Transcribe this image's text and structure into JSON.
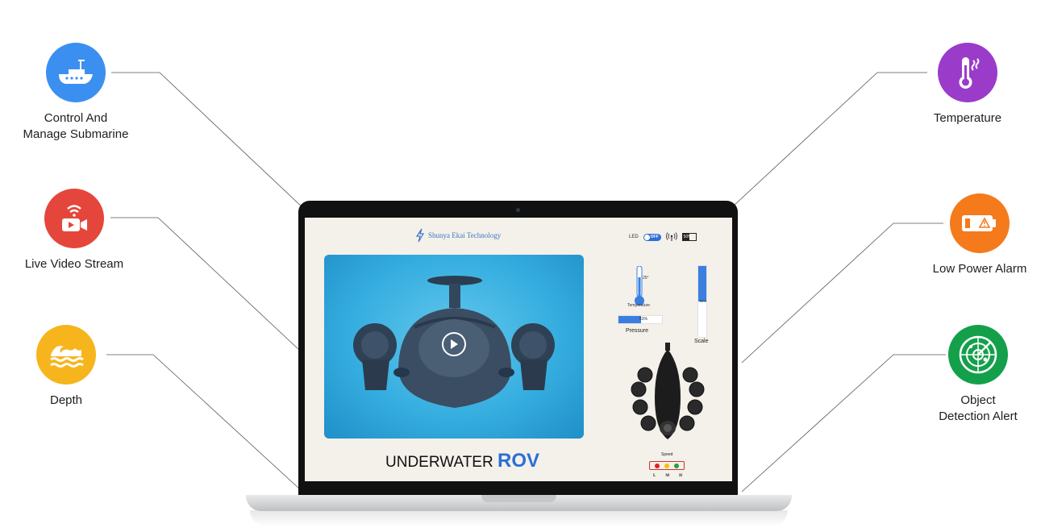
{
  "features_left": [
    {
      "label": "Control And\nManage Submarine",
      "icon": "submarine-icon",
      "color": "#3b8ff0"
    },
    {
      "label": "Live Video Stream",
      "icon": "video-camera-icon",
      "color": "#e5463b"
    },
    {
      "label": "Depth",
      "icon": "water-waves-icon",
      "color": "#f6b51c"
    }
  ],
  "features_right": [
    {
      "label": "Temperature",
      "icon": "thermometer-icon",
      "color": "#9a3cc9"
    },
    {
      "label": "Low Power Alarm",
      "icon": "low-battery-icon",
      "color": "#f57a1c"
    },
    {
      "label": "Object\nDetection Alert",
      "icon": "radar-icon",
      "color": "#14a04b"
    }
  ],
  "app": {
    "brand": "Shunya Ekai Technology",
    "led_label": "LED",
    "led_state": "OFF",
    "battery_text": "50%",
    "battery_level": 0.5,
    "title_prefix": "UNDERWATER",
    "title_main": "ROV",
    "temperature_value": "25°",
    "temperature_label": "Temperature",
    "pressure_value": "51%",
    "pressure_level": 0.51,
    "pressure_label": "Pressure",
    "scale_value": "50%",
    "scale_level": 0.5,
    "scale_label": "Scale",
    "speed_label": "Speed",
    "speed_levels": [
      "L",
      "M",
      "H"
    ],
    "speed_colors": [
      "#e02020",
      "#f2c200",
      "#1aa33a"
    ]
  },
  "colors": {
    "accent": "#2b6fd6",
    "screen_bg": "#f4f0ea",
    "video_bg": "#36aee0"
  }
}
